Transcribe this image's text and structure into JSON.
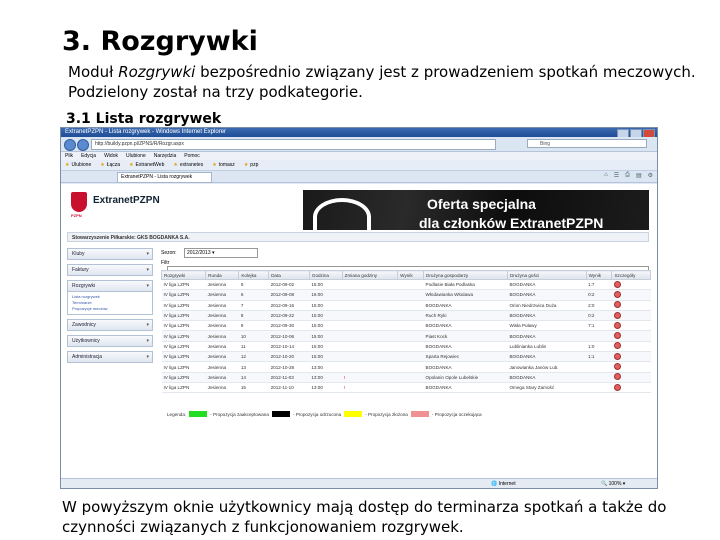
{
  "slide": {
    "title": "3. Rozgrywki",
    "intro_part1": "Moduł ",
    "intro_italic": "Rozgrywki",
    "intro_part2": " bezpośrednio związany jest z prowadzeniem spotkań meczowych.",
    "intro_line2": "Podzielony został na trzy podkategorie.",
    "section": "3.1 Lista rozgrywek",
    "footer": "W powyższym oknie użytkownicy mają dostęp do terminarza spotkań a także do czynności związanych z funkcjonowaniem rozgrywek."
  },
  "browser": {
    "title": "ExtranetPZPN - Lista rozgrywek - Windows Internet Explorer",
    "address": "http://buildy.pzpn.pl/ZPNS/R/Rozgr.aspx",
    "search_placeholder": "Bing",
    "menu": [
      "Plik",
      "Edycja",
      "Widok",
      "Ulubione",
      "Narzędzia",
      "Pomoc"
    ],
    "favorites": [
      "Ulubione",
      "Łącza",
      "ExtranetWeb",
      "extranetes",
      "tomasz",
      "pzp"
    ],
    "tab_label": "ExtranetPZPN - Lista rozgrywek",
    "status_zone": "Internet",
    "zoom": "100%"
  },
  "app": {
    "brand": "ExtranetPZPN",
    "brand_sub": "PZPN",
    "banner_line1": "Oferta specjalna",
    "banner_line2": "dla członków ExtranetPZPN",
    "user_line": "Stowarzyszenie Piłkarskie: GKS BOGDANKA S.A.",
    "sidebar": [
      {
        "label": "Kluby"
      },
      {
        "label": "Faktury"
      },
      {
        "label": "Rozgrywki"
      },
      {
        "label": "Zawodnicy"
      },
      {
        "label": "Użytkownicy"
      },
      {
        "label": "Administracja"
      }
    ],
    "rozgrywki_sub": [
      "Lista rozgrywek",
      "Terminarze",
      "Propozycje meczów"
    ],
    "season_label": "Sezon:",
    "season_value": "2012/2013",
    "filter_label": "Filtr"
  },
  "table": {
    "headers": [
      "Rozgrywki",
      "Runda",
      "Kolejka",
      "Data",
      "Godzina",
      "Zmiana godziny",
      "Wynik",
      "Drużyna gospodarzy",
      "Drużyna gości",
      "Wynik",
      "Szczegóły"
    ],
    "rows": [
      [
        "IV liga LZPN",
        "Jesienna",
        "5",
        "2012-09-02",
        "15:00",
        "",
        "",
        "Podlasie Biała Podlaska",
        "BOGDANKA",
        "1:7"
      ],
      [
        "IV liga LZPN",
        "Jesienna",
        "6",
        "2012-09-08",
        "16:00",
        "",
        "",
        "Włodawianka Włodawa",
        "BOGDANKA",
        "0:2"
      ],
      [
        "IV liga LZPN",
        "Jesienna",
        "7",
        "2012-09-16",
        "15:00",
        "",
        "",
        "BOGDANKA",
        "Orion Niedrzwica Duża",
        "2:0"
      ],
      [
        "IV liga LZPN",
        "Jesienna",
        "8",
        "2012-09-22",
        "15:00",
        "",
        "",
        "Ruch Ryki",
        "BOGDANKA",
        "0:2"
      ],
      [
        "IV liga LZPN",
        "Jesienna",
        "9",
        "2012-09-30",
        "15:00",
        "",
        "",
        "BOGDANKA",
        "Wisła Puławy",
        "7:1"
      ],
      [
        "IV liga LZPN",
        "Jesienna",
        "10",
        "2012-10-06",
        "15:00",
        "",
        "",
        "Piast Kock",
        "BOGDANKA",
        ""
      ],
      [
        "IV liga LZPN",
        "Jesienna",
        "11",
        "2012-10-14",
        "15:00",
        "",
        "",
        "BOGDANKA",
        "Lublinianka Lublin",
        "1:0"
      ],
      [
        "IV liga LZPN",
        "Jesienna",
        "12",
        "2012-10-20",
        "15:00",
        "",
        "",
        "Sparta Rejowiec",
        "BOGDANKA",
        "1:1"
      ],
      [
        "IV liga LZPN",
        "Jesienna",
        "13",
        "2012-10-28",
        "13:00",
        "",
        "",
        "BOGDANKA",
        "Janowianka Janów Lub.",
        ""
      ],
      [
        "IV liga LZPN",
        "Jesienna",
        "14",
        "2012-11-03",
        "13:00",
        "!",
        "",
        "Opolanin Opole Lubelskie",
        "BOGDANKA",
        ""
      ],
      [
        "IV liga LZPN",
        "Jesienna",
        "15",
        "2012-11-10",
        "13:00",
        "!",
        "",
        "BOGDANKA",
        "Omega Stary Zamość",
        ""
      ]
    ]
  },
  "legend": {
    "title": "Legenda:",
    "items": [
      {
        "label": "- Propozycja zaakceptowana",
        "color": "#22dd22"
      },
      {
        "label": "- Propozycja odrzucona",
        "color": "#000000"
      },
      {
        "label": "- Propozycja złożona",
        "color": "#ffff00"
      },
      {
        "label": "- Propozycja oczekująca",
        "color": "#f09090"
      }
    ]
  }
}
